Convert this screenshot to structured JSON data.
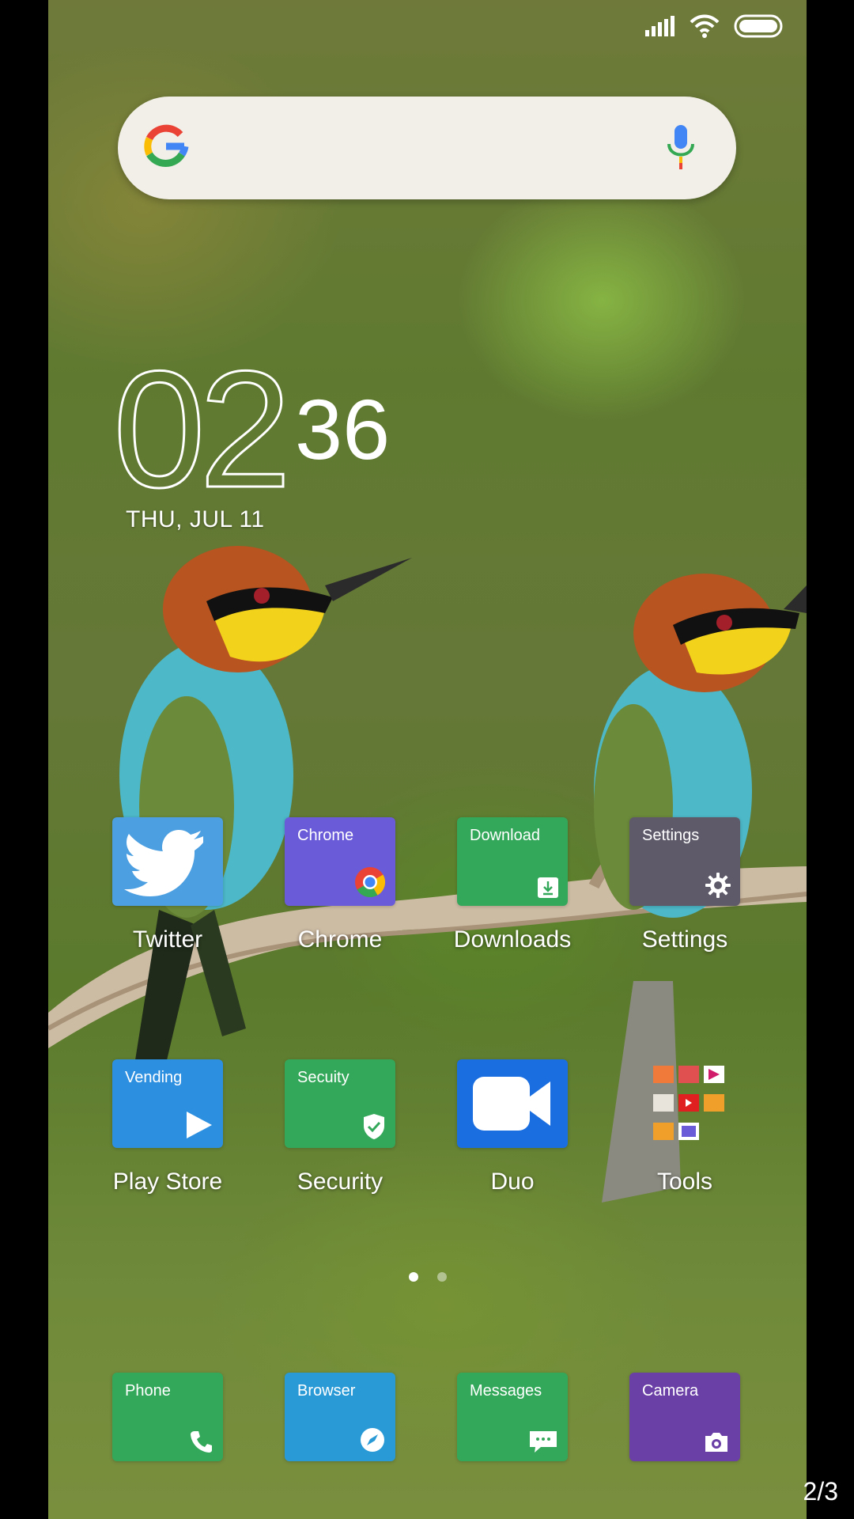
{
  "status_bar": {
    "signal_icon": "signal-icon",
    "wifi_icon": "wifi-icon",
    "battery_icon": "battery-icon"
  },
  "search": {
    "logo": "google-g-icon",
    "mic": "mic-icon"
  },
  "clock": {
    "hour": "02",
    "minute": "36",
    "date": "THU, JUL 11"
  },
  "apps_row1": [
    {
      "label": "Twitter",
      "tile_text": "",
      "color": "#4c9fe0",
      "icon": "twitter-bird-icon"
    },
    {
      "label": "Chrome",
      "tile_text": "Chrome",
      "color": "#6a5bd9",
      "icon": "chrome-icon"
    },
    {
      "label": "Downloads",
      "tile_text": "Download",
      "color": "#34a85a",
      "icon": "download-icon"
    },
    {
      "label": "Settings",
      "tile_text": "Settings",
      "color": "#5f5a6a",
      "icon": "gear-icon"
    }
  ],
  "apps_row2": [
    {
      "label": "Play Store",
      "tile_text": "Vending",
      "color": "#2d8fe0",
      "icon": "play-icon"
    },
    {
      "label": "Security",
      "tile_text": "Secuity",
      "color": "#34a85a",
      "icon": "shield-check-icon"
    },
    {
      "label": "Duo",
      "tile_text": "",
      "color": "#1a6ee0",
      "icon": "video-camera-icon"
    },
    {
      "label": "Tools",
      "tile_text": "",
      "color": "",
      "icon": "folder-icon"
    }
  ],
  "page_indicator": {
    "pages": 2,
    "active": 1
  },
  "dock": [
    {
      "tile_text": "Phone",
      "color": "#34a85a",
      "icon": "phone-icon"
    },
    {
      "tile_text": "Browser",
      "color": "#2a9ad6",
      "icon": "browser-icon"
    },
    {
      "tile_text": "Messages",
      "color": "#34a85a",
      "icon": "message-icon"
    },
    {
      "tile_text": "Camera",
      "color": "#6a3fa6",
      "icon": "camera-icon"
    }
  ],
  "pager_text": "2/3"
}
